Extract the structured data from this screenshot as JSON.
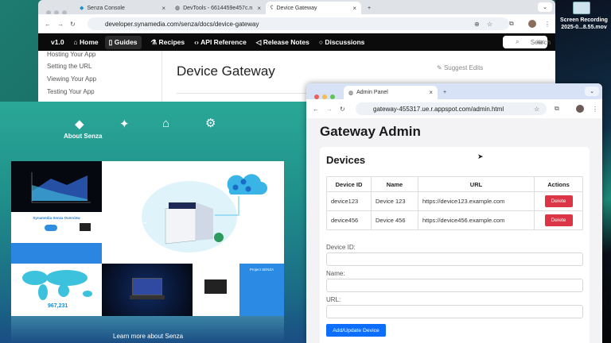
{
  "desktop": {
    "recording_label": "Screen Recording 2025-0...8.55.mov"
  },
  "back_browser": {
    "tabs": [
      {
        "label": "Senza Console"
      },
      {
        "label": "DevTools - 6614459e457c.n"
      },
      {
        "label": "Device Gateway"
      }
    ],
    "url": "developer.synamedia.com/senza/docs/device-gateway",
    "nav": {
      "version": "v1.0",
      "items": [
        "Home",
        "Guides",
        "Recipes",
        "API Reference",
        "Release Notes",
        "Discussions"
      ],
      "search_placeholder": "Search",
      "shortcut": "⌘K"
    },
    "sidebar": [
      "Hosting Your App",
      "Setting the URL",
      "Viewing Your App",
      "Testing Your App"
    ],
    "page_title": "Device Gateway",
    "suggest_edits": "Suggest Edits"
  },
  "senza": {
    "menu": [
      {
        "icon": "senza-logo-icon",
        "label": "About Senza"
      },
      {
        "icon": "sparkles-icon"
      },
      {
        "icon": "home-remote-icon"
      },
      {
        "icon": "gear-icon"
      }
    ],
    "tiles": {
      "overview_title": "Synamedia Senza Overview",
      "map_number": "967,231",
      "project_title": "Project SENZA"
    },
    "learn_more": "Learn more about Senza"
  },
  "admin_browser": {
    "tab": "Admin Panel",
    "url": "gateway-455317.ue.r.appspot.com/admin.html",
    "title": "Gateway Admin",
    "section": "Devices",
    "columns": [
      "Device ID",
      "Name",
      "URL",
      "Actions"
    ],
    "rows": [
      {
        "id": "device123",
        "name": "Device 123",
        "url": "https://device123.example.com",
        "action": "Delete"
      },
      {
        "id": "device456",
        "name": "Device 456",
        "url": "https://device456.example.com",
        "action": "Delete"
      }
    ],
    "form": {
      "device_id_label": "Device ID:",
      "name_label": "Name:",
      "url_label": "URL:",
      "submit": "Add/Update Device"
    },
    "colors": {
      "delete": "#dc3545",
      "primary": "#0d6efd"
    }
  }
}
